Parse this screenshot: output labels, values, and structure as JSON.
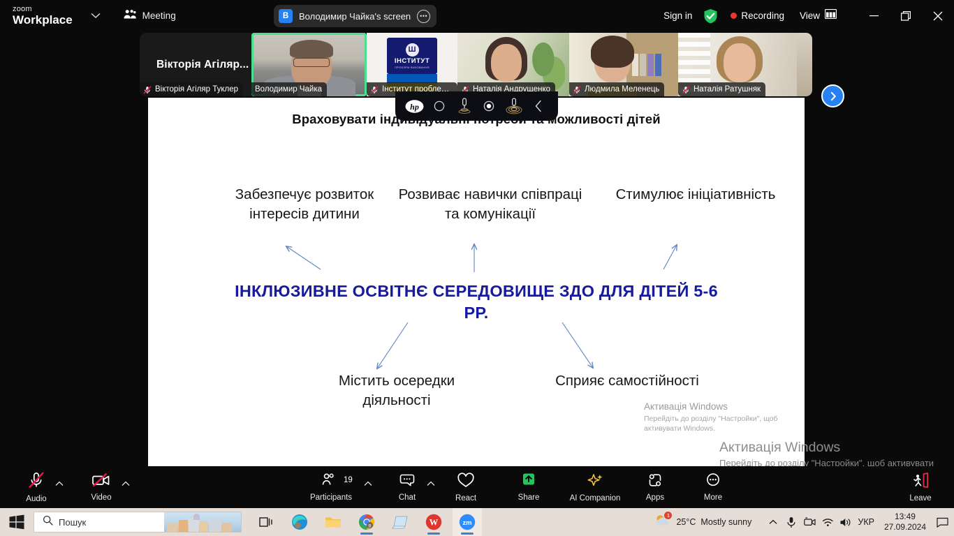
{
  "titlebar": {
    "brand_small": "zoom",
    "brand_big": "Workplace",
    "chevron_icon": "chevron-down-icon",
    "meeting_label": "Meeting",
    "meeting_icon": "people-icon",
    "screen_share_badge": "В",
    "screen_share_label": "Володимир Чайка's screen",
    "more_icon": "ellipsis-icon",
    "sign_in": "Sign in",
    "shield_icon": "shield-check-icon",
    "recording_label": "Recording",
    "view_label": "View",
    "view_icon": "layout-grid-icon",
    "minimize_icon": "minimize-icon",
    "restore_icon": "restore-icon",
    "close_icon": "close-icon"
  },
  "gallery": {
    "avatar_tile_name": "Вікторія Агіляр...",
    "next_icon": "chevron-right-icon",
    "participants": [
      {
        "name": "Вікторія Агіляр Туклер",
        "muted": true,
        "active": false
      },
      {
        "name": "Володимир Чайка",
        "muted": false,
        "active": true
      },
      {
        "name": "Інститут проблем вих...",
        "muted": true,
        "active": false
      },
      {
        "name": "Наталія Андрущенко",
        "muted": true,
        "active": false
      },
      {
        "name": "Людмила Меленець",
        "muted": true,
        "active": false
      },
      {
        "name": "Наталія Ратушняк",
        "muted": true,
        "active": false
      }
    ],
    "institute_logo": {
      "seal": "Ш",
      "line1": "ІНСТИТУТ",
      "line2": "ПРОБЛЕМ ВИХОВАННЯ"
    }
  },
  "hp_overlay": {
    "logo": "hp-logo-icon",
    "buttons": [
      {
        "icon": "circle-outline-icon",
        "label": "mute-toggle"
      },
      {
        "icon": "microphone-waves-icon",
        "label": "mic-pickup"
      },
      {
        "icon": "circle-filled-icon",
        "label": "record-toggle"
      },
      {
        "icon": "microphone-rings-icon",
        "label": "mic-range"
      },
      {
        "icon": "chevron-left-icon",
        "label": "collapse"
      }
    ]
  },
  "slide": {
    "title": "Враховувати індивідуальні потреби та можливості дітей",
    "center_title": "ІНКЛЮЗИВНЕ ОСВІТНЄ СЕРЕДОВИЩЕ ЗДО ДЛЯ ДІТЕЙ 5-6 РР.",
    "nodes": {
      "top_left": "Забезпечує розвиток інтересів дитини",
      "top_center": "Розвиває навички співпраці та комунікації",
      "top_right": "Стимулює ініціативність",
      "bottom_left": "Містить осередки діяльності",
      "bottom_right": "Сприяє самостійності"
    },
    "accent_color": "#161b9e",
    "arrow_color": "#5b84c4"
  },
  "watermark": {
    "small": {
      "heading": "Активація Windows",
      "body": "Перейдіть до розділу \"Настройки\", щоб активувати Windows."
    },
    "large": {
      "heading": "Активація Windows",
      "body": "Перейдіть до розділу \"Настройки\", щоб активувати Windows."
    }
  },
  "zoom_toolbar": {
    "items": [
      {
        "label": "Audio",
        "icon": "microphone-muted-icon",
        "has_caret": true,
        "muted": true
      },
      {
        "label": "Video",
        "icon": "camera-muted-icon",
        "has_caret": true,
        "muted": true
      },
      {
        "label": "Participants",
        "icon": "participants-icon",
        "has_caret": true,
        "count": "19"
      },
      {
        "label": "Chat",
        "icon": "chat-bubble-icon",
        "has_caret": true
      },
      {
        "label": "React",
        "icon": "heart-icon",
        "has_caret": false
      },
      {
        "label": "Share",
        "icon": "share-screen-icon",
        "has_caret": false
      },
      {
        "label": "AI Companion",
        "icon": "sparkle-icon",
        "has_caret": false
      },
      {
        "label": "Apps",
        "icon": "apps-icon",
        "has_caret": false
      },
      {
        "label": "More",
        "icon": "more-ellipsis-icon",
        "has_caret": false
      },
      {
        "label": "Leave",
        "icon": "leave-door-icon",
        "has_caret": false
      }
    ],
    "share_color": "#22c55e",
    "leave_color": "#e02f4d",
    "mute_slash_color": "#e8194b"
  },
  "taskbar": {
    "start_icon": "windows-start-icon",
    "search_placeholder": "Пошук",
    "search_icon": "search-icon",
    "task_view_icon": "task-view-icon",
    "apps": [
      {
        "name": "edge-icon",
        "running": false
      },
      {
        "name": "explorer-icon",
        "running": false
      },
      {
        "name": "chrome-icon",
        "running": true
      },
      {
        "name": "notepad-icon",
        "running": false
      },
      {
        "name": "wps-icon",
        "running": true
      },
      {
        "name": "zoom-icon",
        "running": true,
        "active": true
      }
    ],
    "tray": {
      "weather_icon": "weather-sun-cloud-icon",
      "weather_badge": "1",
      "temperature": "25°C",
      "condition": "Mostly sunny",
      "overflow_icon": "chevron-up-icon",
      "mic_icon": "microphone-icon",
      "camera_icon": "camera-icon",
      "network_icon": "wifi-icon",
      "volume_icon": "volume-icon",
      "language": "УКР",
      "time": "13:49",
      "date": "27.09.2024",
      "notification_icon": "notification-icon"
    }
  }
}
